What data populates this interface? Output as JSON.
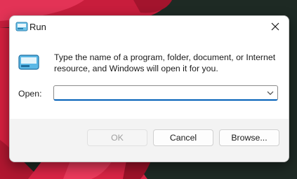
{
  "window": {
    "title": "Run"
  },
  "description": "Type the name of a program, folder, document, or Internet resource, and Windows will open it for you.",
  "open_field": {
    "label": "Open:",
    "value": ""
  },
  "buttons": {
    "ok": "OK",
    "cancel": "Cancel",
    "browse": "Browse..."
  },
  "icons": {
    "app": "run-icon",
    "close": "close-icon",
    "dropdown": "chevron-down-icon"
  },
  "colors": {
    "accent": "#005fb8",
    "wallpaper_petal": "#e0264a",
    "wallpaper_dark": "#1e2a24"
  }
}
